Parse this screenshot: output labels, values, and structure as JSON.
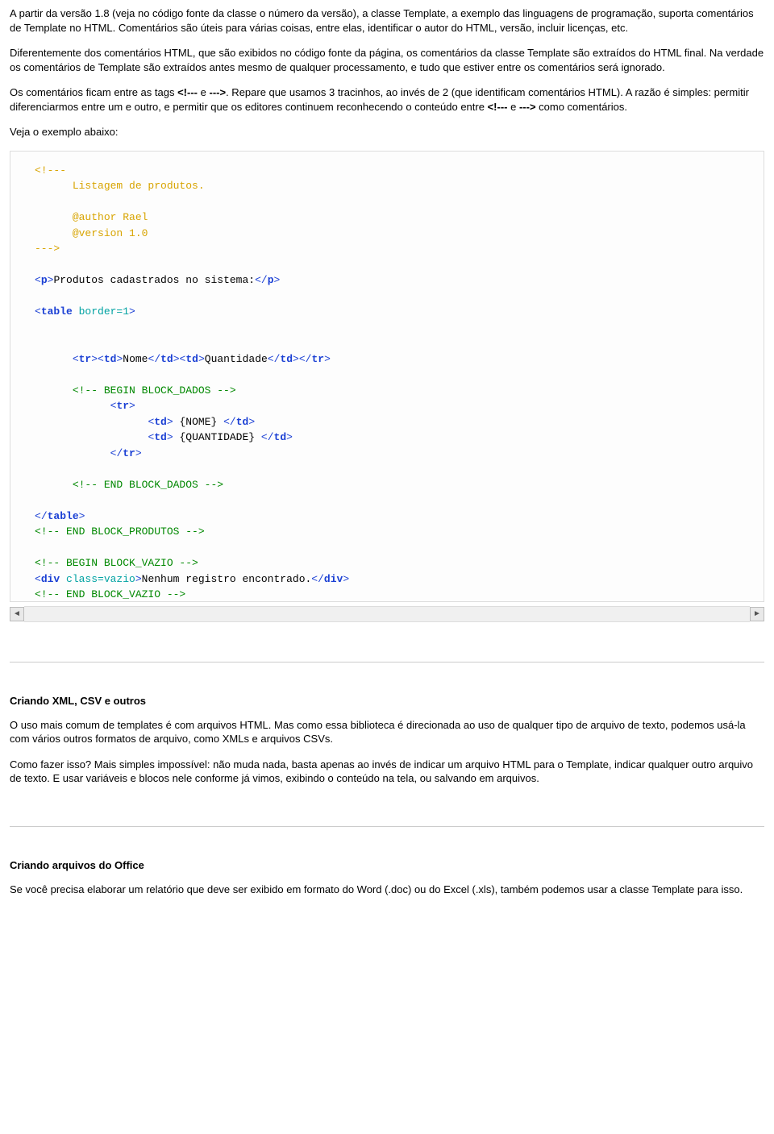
{
  "intro": {
    "p1_a": "A partir da versão 1.8 (veja no código fonte da classe o número da versão), a classe Template, a exemplo das linguagens de programação, suporta comentários de Template no HTML. Comentários são úteis para várias coisas, entre elas, identificar o autor do HTML, versão, incluir licenças, etc.",
    "p2": "Diferentemente dos comentários HTML, que são exibidos no código fonte da página, os comentários da classe Template são extraídos do HTML final. Na verdade os comentários de Template são extraídos antes mesmo de qualquer processamento, e tudo que estiver entre os comentários será ignorado.",
    "p3_a": "Os comentários ficam entre as tags ",
    "p3_b": "<!---",
    "p3_c": " e ",
    "p3_d": "--->",
    "p3_e": ". Repare que usamos 3 tracinhos, ao invés de 2 (que identificam comentários HTML). A razão é simples: permitir diferenciarmos entre um e outro, e permitir que os editores continuem reconhecendo o conteúdo entre ",
    "p3_f": "<!---",
    "p3_g": " e ",
    "p3_h": "--->",
    "p3_i": " como comentários.",
    "p4": "Veja o exemplo abaixo:"
  },
  "code": {
    "c_open": "<!---",
    "c_line1": "Listagem de produtos.",
    "c_line2": "@author Rael",
    "c_line3": "@version 1.0",
    "c_close": "--->",
    "lt": "<",
    "gt": ">",
    "slash": "/",
    "tag_p": "p",
    "p_text": "Produtos cadastrados no sistema:",
    "tag_table": "table",
    "attr_border": " border=1",
    "tag_tr": "tr",
    "tag_td": "td",
    "hdr_nome": "Nome",
    "hdr_qtd": "Quantidade",
    "cmt_begin_dados": "<!-- BEGIN BLOCK_DADOS -->",
    "var_nome": " {NOME} ",
    "var_qtd": " {QUANTIDADE} ",
    "cmt_end_dados": "<!-- END BLOCK_DADOS -->",
    "cmt_end_produtos": "<!-- END BLOCK_PRODUTOS -->",
    "cmt_begin_vazio": "<!-- BEGIN BLOCK_VAZIO -->",
    "tag_div": "div",
    "attr_class_vazio": " class=vazio",
    "div_text": "Nenhum registro encontrado.",
    "cmt_end_vazio": "<!-- END BLOCK_VAZIO -->"
  },
  "sec_xml": {
    "title": "Criando XML, CSV e outros",
    "p1": "O uso mais comum de templates é com arquivos HTML. Mas como essa biblioteca é direcionada ao uso de qualquer tipo de arquivo de texto, podemos usá-la com vários outros formatos de arquivo, como XMLs e arquivos CSVs.",
    "p2": "Como fazer isso? Mais simples impossível: não muda nada, basta apenas ao invés de indicar um arquivo HTML para o Template, indicar qualquer outro arquivo de texto. E usar variáveis e blocos nele conforme já vimos, exibindo o conteúdo na tela, ou salvando em arquivos."
  },
  "sec_office": {
    "title": "Criando arquivos do Office",
    "p1": "Se você precisa elaborar um relatório que deve ser exibido em formato do Word (.doc) ou do Excel (.xls), também podemos usar a classe Template para isso."
  },
  "arrows": {
    "left": "◄",
    "right": "►"
  }
}
